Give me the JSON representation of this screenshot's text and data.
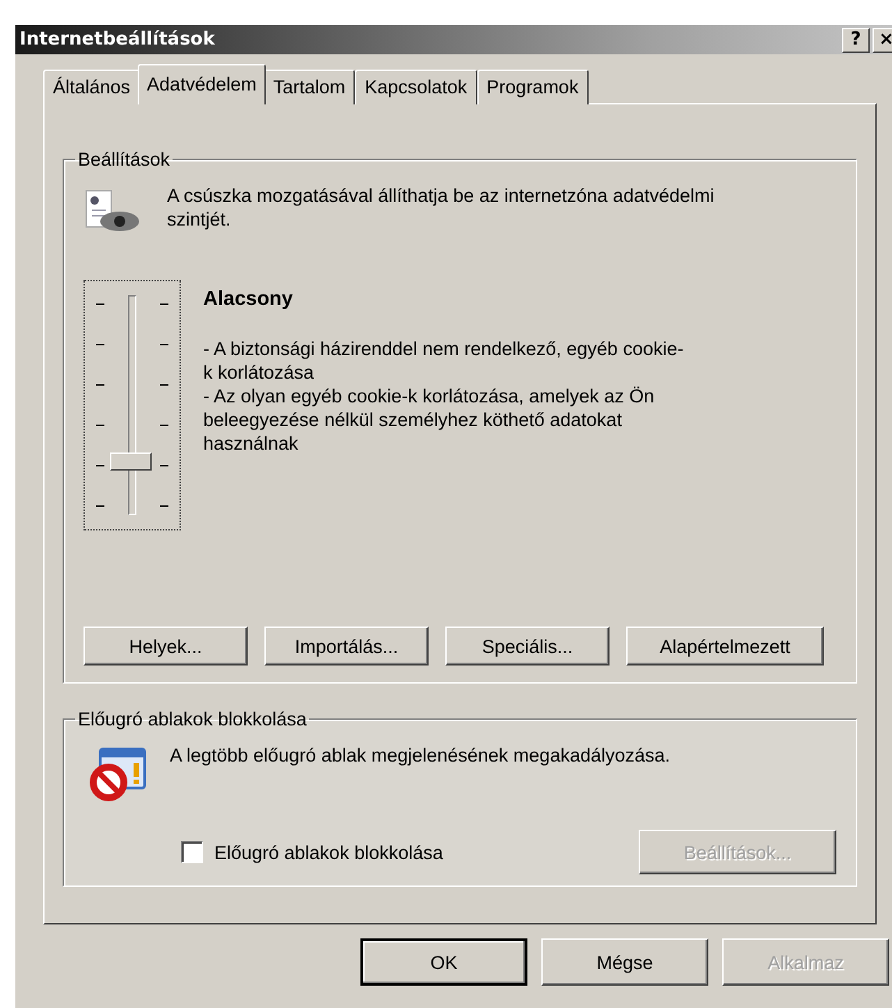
{
  "window": {
    "title": "Internetbeállítások",
    "help_button": "?",
    "close_button": "×"
  },
  "tabs": [
    {
      "label": "Általános",
      "selected": false
    },
    {
      "label": "Adatvédelem",
      "selected": true
    },
    {
      "label": "Tartalom",
      "selected": false
    },
    {
      "label": "Kapcsolatok",
      "selected": false
    },
    {
      "label": "Programok",
      "selected": false
    }
  ],
  "settings_group": {
    "title": "Beállítások",
    "intro": "A csúszka mozgatásával állíthatja be az internetzóna adatvédelmi szintjét.",
    "slider": {
      "level": 0.2
    },
    "level_name": "Alacsony",
    "description": [
      "- A biztonsági házirenddel nem rendelkező, egyéb cookie-k korlátozása",
      "- Az olyan egyéb cookie-k korlátozása, amelyek az Ön beleegyezése nélkül személyhez köthető adatokat használnak"
    ],
    "buttons": [
      {
        "label": "Helyek...",
        "disabled": false
      },
      {
        "label": "Importálás...",
        "disabled": false
      },
      {
        "label": "Speciális...",
        "disabled": false
      },
      {
        "label": "Alapértelmezett",
        "disabled": false
      }
    ]
  },
  "popup_group": {
    "title": "Előugró ablakok blokkolása",
    "intro": "A legtöbb előugró ablak megjelenésének megakadályozása.",
    "checkbox": {
      "label": "Előugró ablakok blokkolása",
      "checked": false
    },
    "settings_button": {
      "label": "Beállítások...",
      "disabled": true
    }
  },
  "buttons": [
    {
      "label": "OK",
      "default": true,
      "disabled": false
    },
    {
      "label": "Mégse",
      "default": false,
      "disabled": false
    },
    {
      "label": "Alkalmaz",
      "default": false,
      "disabled": true
    }
  ]
}
